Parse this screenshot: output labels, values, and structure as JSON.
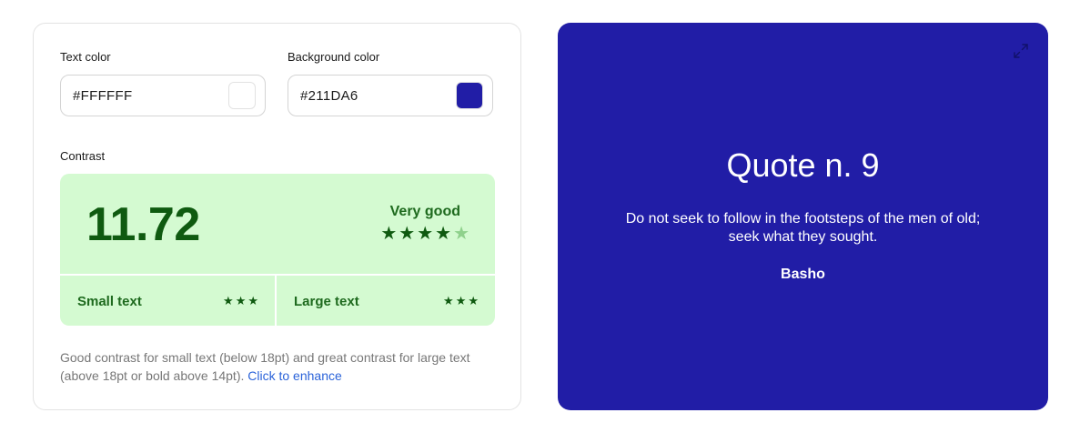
{
  "text_color": {
    "label": "Text color",
    "value": "#FFFFFF",
    "swatch": "#FFFFFF"
  },
  "background_color": {
    "label": "Background color",
    "value": "#211DA6",
    "swatch": "#211DA6"
  },
  "contrast": {
    "label": "Contrast",
    "score": "11.72",
    "rating": "Very good",
    "stars_filled": 4,
    "stars_total": 5,
    "small_text": {
      "label": "Small text",
      "stars": 3
    },
    "large_text": {
      "label": "Large text",
      "stars": 3
    },
    "description": "Good contrast for small text (below 18pt) and great contrast for large text (above 18pt or bold above 14pt).",
    "enhance_link": "Click to enhance"
  },
  "preview": {
    "title": "Quote n. 9",
    "quote_line1": "Do not seek to follow in the footsteps of the men of old;",
    "quote_line2": "seek what they sought.",
    "author": "Basho",
    "expand_icon": "expand-icon"
  },
  "colors": {
    "score_bg": "#d4fad1",
    "score_text": "#0f5a10",
    "link": "#2b63d9"
  }
}
